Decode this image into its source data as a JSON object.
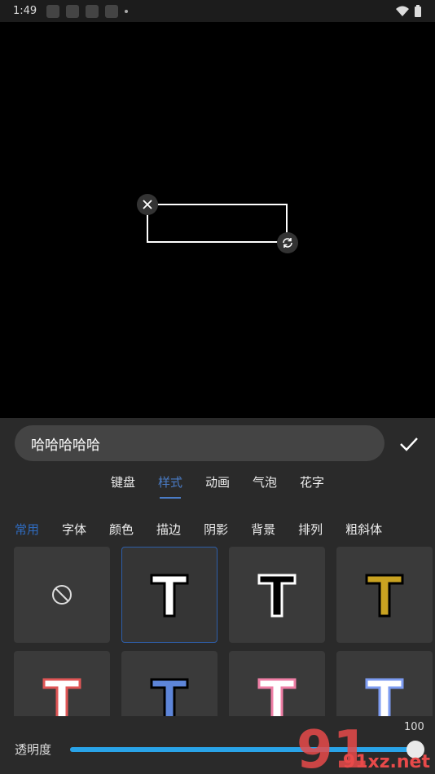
{
  "status_bar": {
    "time": "1:49"
  },
  "editor": {
    "text_value": "哈哈哈哈哈"
  },
  "main_tabs": [
    {
      "label": "键盘",
      "active": false
    },
    {
      "label": "样式",
      "active": true
    },
    {
      "label": "动画",
      "active": false
    },
    {
      "label": "气泡",
      "active": false
    },
    {
      "label": "花字",
      "active": false
    }
  ],
  "sub_tabs": [
    {
      "label": "常用",
      "active": true
    },
    {
      "label": "字体",
      "active": false
    },
    {
      "label": "颜色",
      "active": false
    },
    {
      "label": "描边",
      "active": false
    },
    {
      "label": "阴影",
      "active": false
    },
    {
      "label": "背景",
      "active": false
    },
    {
      "label": "排列",
      "active": false
    },
    {
      "label": "粗斜体",
      "active": false
    }
  ],
  "styles": [
    {
      "icon": "none-icon",
      "fill": "",
      "stroke": ""
    },
    {
      "icon": "T",
      "fill": "#ffffff",
      "stroke": "#000000"
    },
    {
      "icon": "T",
      "fill": "#000000",
      "stroke": "#ffffff"
    },
    {
      "icon": "T",
      "fill": "#c9a221",
      "stroke": "#000000"
    },
    {
      "icon": "T",
      "fill": "#ffffff",
      "stroke": "#e05656"
    },
    {
      "icon": "T",
      "fill": "#5d85d9",
      "stroke": "#000000"
    },
    {
      "icon": "T",
      "fill": "#ffffff",
      "stroke": "#ef7fa6"
    },
    {
      "icon": "T",
      "fill": "#ffffff",
      "stroke": "#7c9bf0"
    }
  ],
  "opacity": {
    "label": "透明度",
    "value": "100",
    "fraction": 1.0
  },
  "watermark": {
    "text": "91xz.net"
  },
  "colors": {
    "accent": "#4a7cc7",
    "slider": "#29a3e8"
  }
}
